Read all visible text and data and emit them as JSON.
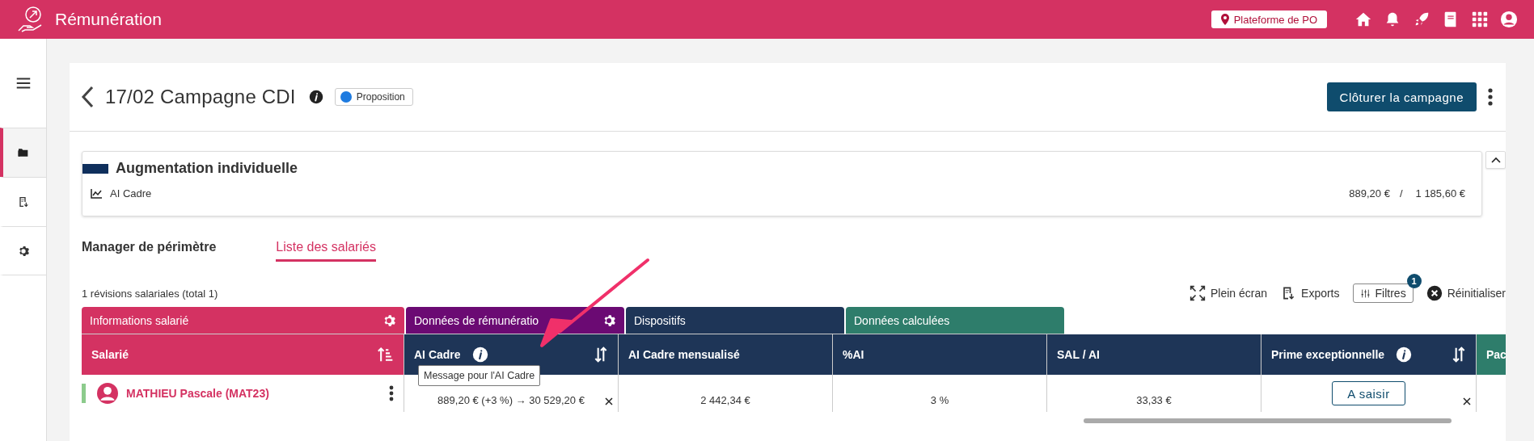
{
  "app": {
    "title": "Rémunération",
    "location": "Plateforme de PO"
  },
  "sidebar": {
    "items": [
      {
        "kind": "folder",
        "selected": true
      },
      {
        "kind": "export",
        "selected": false
      },
      {
        "kind": "settings",
        "selected": false
      }
    ]
  },
  "campaign": {
    "title": "17/02 Campagne CDI",
    "status": {
      "label": "Proposition",
      "color": "#1e7be0"
    },
    "action": "Clôturer la campagne"
  },
  "summary": {
    "title": "Augmentation individuelle",
    "expanded": true,
    "line": {
      "label": "AI Cadre",
      "value": "889,20 €",
      "separator": "/",
      "total": "1 185,60 €"
    }
  },
  "tabs": [
    {
      "label": "Manager de périmètre",
      "selected": false
    },
    {
      "label": "Liste des salariés",
      "selected": true
    }
  ],
  "table": {
    "count": "1 révisions salariales (total 1)",
    "toolbar": [
      {
        "kind": "fullscreen",
        "label": "Plein écran"
      },
      {
        "kind": "export",
        "label": "Exports"
      },
      {
        "kind": "filter",
        "label": "Filtres",
        "badge": "1"
      },
      {
        "kind": "reset",
        "label": "Réinitialiser"
      }
    ],
    "groups": [
      {
        "label": "Informations salarié",
        "color": "#d43262",
        "settings": true
      },
      {
        "label": "Données de rémunératio",
        "color": "#6b0a73",
        "settings": true
      },
      {
        "label": "Dispositifs",
        "color": "#1e3557",
        "settings": false
      },
      {
        "label": "Données calculées",
        "color": "#2e7d6b",
        "settings": false
      }
    ],
    "columns": [
      {
        "label": "Salarié",
        "color": "#d43262",
        "info": false,
        "sortable": true,
        "sorted": true
      },
      {
        "label": "AI Cadre",
        "color": "#1e3557",
        "info": true,
        "sortable": true,
        "sorted": false
      },
      {
        "label": "AI Cadre mensualisé",
        "color": "#1e3557",
        "info": false,
        "sortable": false
      },
      {
        "label": "%AI",
        "color": "#1e3557",
        "info": false,
        "sortable": false
      },
      {
        "label": "SAL / AI",
        "color": "#1e3557",
        "info": false,
        "sortable": false
      },
      {
        "label": "Prime exceptionnelle",
        "color": "#1e3557",
        "info": true,
        "sortable": true,
        "sorted": false
      },
      {
        "label": "Pac",
        "color": "#2e7d6b",
        "info": false,
        "sortable": false
      }
    ],
    "tooltip": "Message pour l'AI Cadre",
    "rows": [
      {
        "cells": [
          {
            "kind": "employee",
            "text": "MATHIEU Pascale (MAT23)",
            "color": "#8ccb8c"
          },
          {
            "kind": "text",
            "text": "889,20 € (+3 %) → 30 529,20 €",
            "clearable": true
          },
          {
            "kind": "text",
            "text": "2 442,34 €",
            "clearable": false
          },
          {
            "kind": "text",
            "text": "3 %",
            "clearable": false
          },
          {
            "kind": "text",
            "text": "33,33 €",
            "clearable": false
          },
          {
            "kind": "button",
            "text": "A saisir",
            "clearable": true
          }
        ]
      }
    ]
  }
}
